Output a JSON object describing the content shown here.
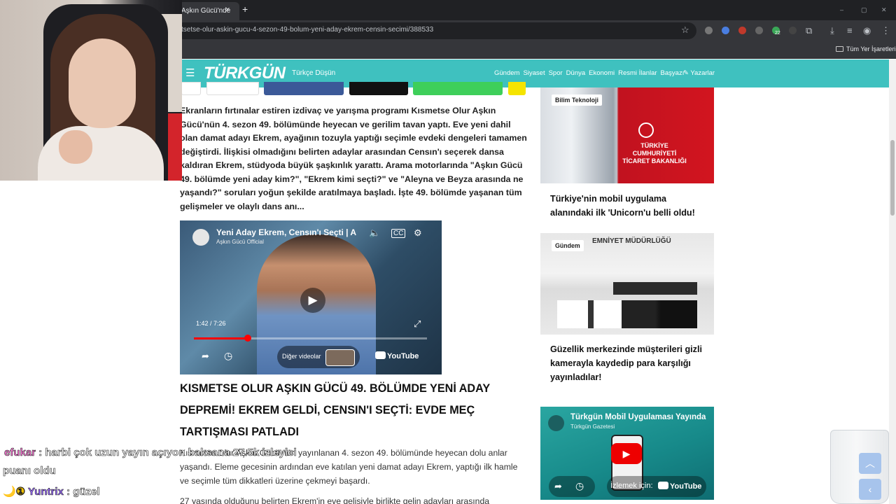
{
  "browser": {
    "tab_title": "Aşkın Gücü'nde",
    "tab_close": "×",
    "new_tab": "+",
    "window_controls": [
      "–",
      "▢",
      "✕"
    ],
    "url": "tsetse-olur-askin-gucu-4-sezon-49-bolum-yeni-aday-ekrem-censin-secimi/388533",
    "extension_badge": "22",
    "bookmarks_label": "Tüm Yer İşaretleri"
  },
  "site": {
    "logo": "TÜRKGÜN",
    "tagline": "Türkçe Düşün",
    "nav": [
      "Gündem",
      "Siyaset",
      "Spor",
      "Dünya",
      "Ekonomi",
      "Resmi İlanlar",
      "Başyazı"
    ],
    "writers": "✎ Yazarlar",
    "brand_color": "#3fc1bf"
  },
  "article": {
    "lead": "Ekranların fırtınalar estiren izdivaç ve yarışma programı Kısmetse Olur Aşkın Gücü'nün 4. sezon 49. bölümünde heyecan ve gerilim tavan yaptı. Eve yeni dahil olan damat adayı Ekrem, ayağının tozuyla yaptığı seçimle evdeki dengeleri tamamen değiştirdi. İlişkisi olmadığını belirten adaylar arasından Censın'ı seçerek dansa kaldıran Ekrem, stüdyoda büyük şaşkınlık yarattı. Arama motorlarında \"Aşkın Gücü 49. bölümde yeni aday kim?\", \"Ekrem kimi seçti?\" ve \"Aleyna ve Beyza arasında ne yaşandı?\" soruları yoğun şekilde aratılmaya başladı. İşte 49. bölümde yaşanan tüm gelişmeler ve olaylı dans anı...",
    "video": {
      "title": "Yeni Aday Ekrem, Censın'ı Seçti | A",
      "channel": "Aşkın Gücü Official",
      "time": "1:42 / 7:26",
      "progress": 0.23,
      "more_videos": "Diğer videolar",
      "youtube": "YouTube"
    },
    "heading": "KISMETSE OLUR AŞKIN GÜCÜ 49. BÖLÜMDE YENİ ADAY DEPREMİ! EKREM GELDİ, CENSIN'I SEÇTİ: EVDE MEÇ TARTIŞMASI PATLADI",
    "body": "Kısmetse Olur Aşkın Gücü'nün yayınlanan 4. sezon 49. bölümünde heyecan dolu anlar yaşandı. Eleme gecesinin ardından eve katılan yeni damat adayı Ekrem, yaptığı ilk hamle ve seçimle tüm dikkatleri üzerine çekmeyi başardı.",
    "body2": "27 yaşında olduğunu belirten Ekrem'in eve gelişiyle birlikte gelin adayları arasında"
  },
  "sidebar": {
    "cards": [
      {
        "category": "Bilim Teknoloji",
        "title": "Türkiye'nin mobil uygulama alanındaki ilk 'Unicorn'u belli oldu!",
        "sign_text": "TÜRKİYE CUMHURİYETİ TİCARET BAKANLIĞI"
      },
      {
        "category": "Gündem",
        "title": "Güzellik merkezinde müşterileri gizli kamerayla kaydedip para karşılığı yayınladılar!",
        "sign_text": "EMNİYET MÜDÜRLÜĞÜ"
      }
    ],
    "promo": {
      "title": "Türkgün Mobil Uygulaması Yayında",
      "channel": "Türkgün Gazetesi",
      "watch": "İzlemek için:",
      "youtube": "YouTube"
    }
  },
  "chat": [
    {
      "user": "efukar",
      "message": ": harbi çok uzun yayın açıyon baksana 27.5k izleyici"
    },
    {
      "user": "",
      "message": "puanı oldu"
    },
    {
      "user": "Yuntrix",
      "message": ": güzel"
    }
  ],
  "fab": {
    "up": "︿",
    "left": "‹"
  }
}
